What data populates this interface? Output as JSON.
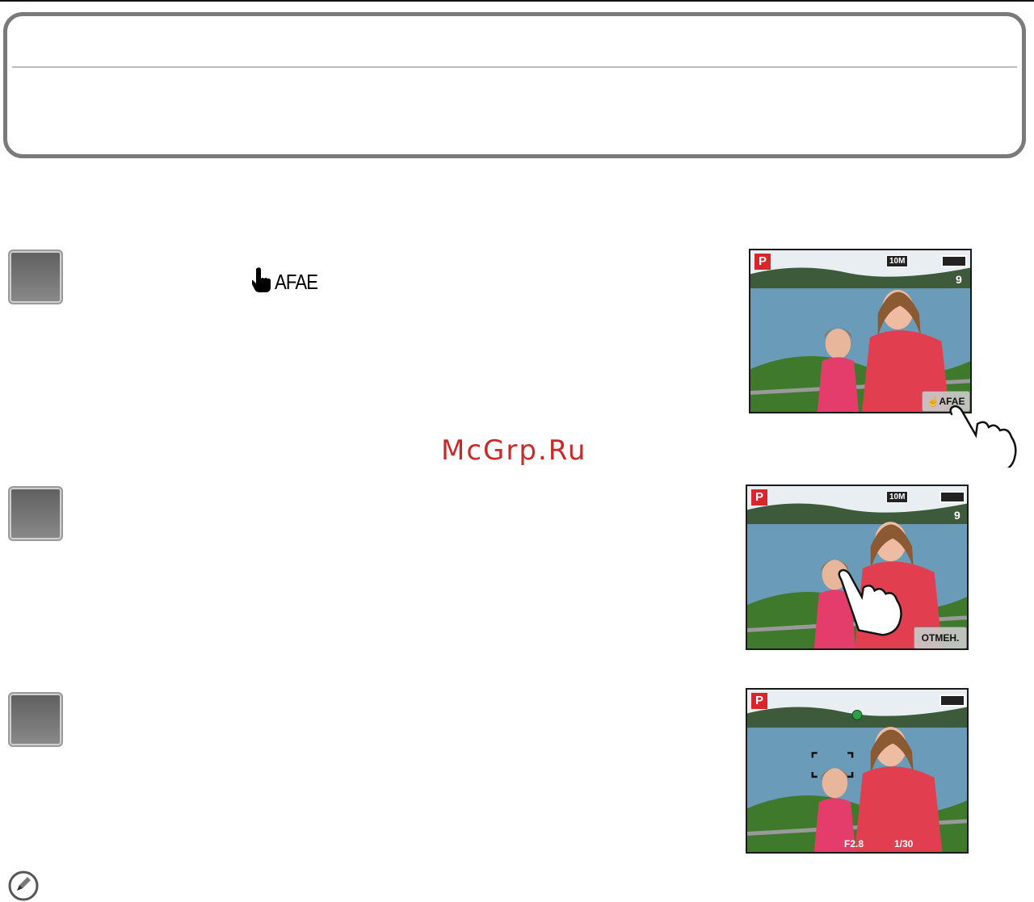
{
  "page": {
    "watermark": "McGrp.Ru"
  },
  "step1": {
    "afae_label": "AFAE",
    "screen": {
      "mode": "P",
      "resolution": "10M",
      "count": "9",
      "afae_button": "AFAE"
    }
  },
  "step2": {
    "screen": {
      "mode": "P",
      "resolution": "10M",
      "count": "9",
      "cancel_button": "ОТМЕН."
    }
  },
  "step3": {
    "screen": {
      "mode": "P",
      "aperture": "F2.8",
      "shutter": "1/30"
    }
  },
  "icons": [
    "hand-pointer-icon",
    "note-icon"
  ],
  "colors": {
    "border_gray": "#7a7a7a",
    "badge_dark": "#5f5f5f",
    "watermark_red": "#cc2828",
    "mode_red": "#d8262b"
  }
}
